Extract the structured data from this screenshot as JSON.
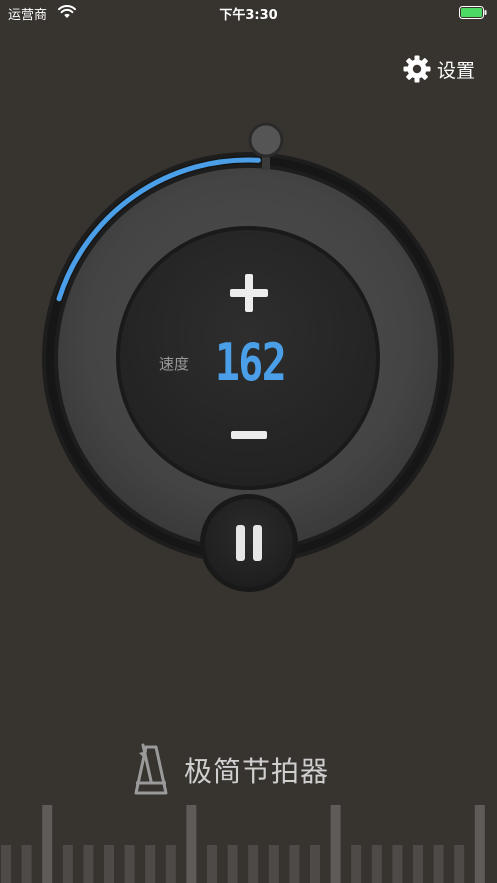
{
  "status_bar": {
    "carrier": "运营商",
    "time": "下午3:30"
  },
  "settings": {
    "label": "设置"
  },
  "tempo": {
    "label": "速度",
    "value": "162",
    "progress_fraction": 0.21
  },
  "brand": {
    "name": "极简节拍器"
  },
  "colors": {
    "background": "#37332f",
    "accent": "#4a9fe8",
    "battery": "#4cd964"
  },
  "icons": {
    "wifi": "wifi-icon",
    "battery": "battery-icon",
    "settings": "gear-icon",
    "increase": "plus-icon",
    "decrease": "minus-icon",
    "pause": "pause-icon",
    "logo": "metronome-icon"
  }
}
